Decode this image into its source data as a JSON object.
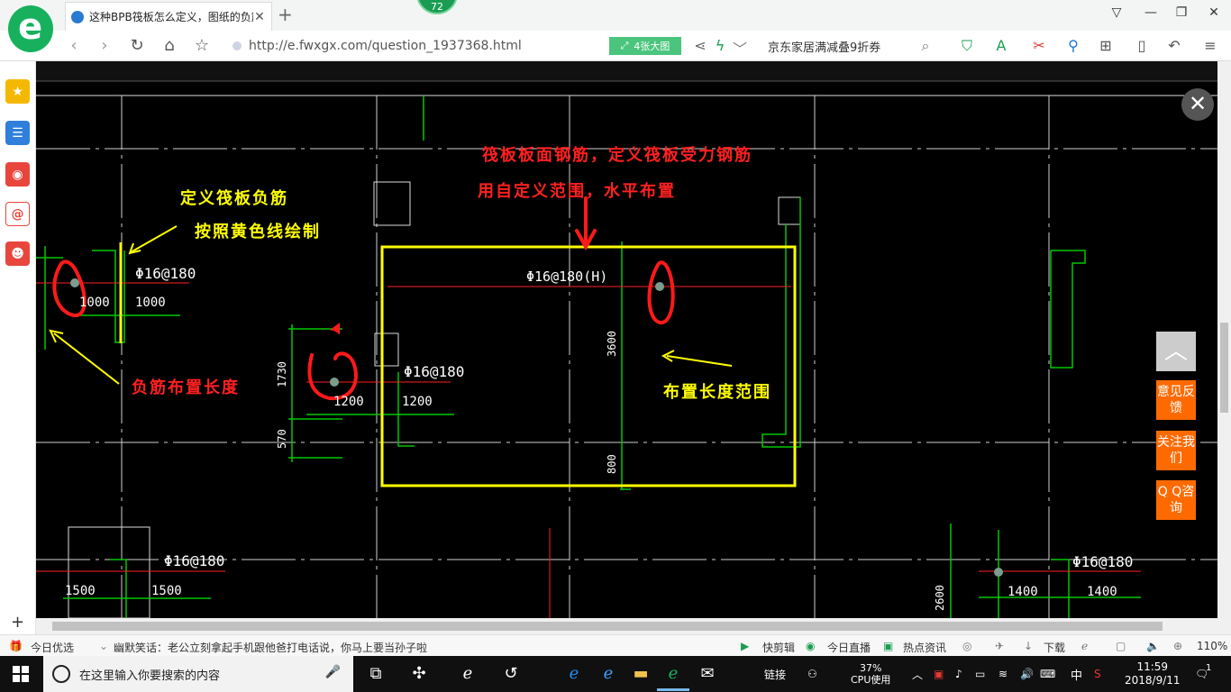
{
  "browser": {
    "tab_title": "这种BPB筏板怎么定义，图纸的负筋",
    "tab_close": "✕",
    "new_tab": "+",
    "badge": "72",
    "url": "http://e.fwxgx.com/question_1937368.html",
    "big_image_label": "4张大图",
    "search_hint": "京东家居满减叠9折券"
  },
  "drawing": {
    "title_line1": "筏板板面钢筋，定义筏板受力钢筋",
    "title_line2": "用自定义范围，水平布置",
    "note_neg1": "定义筏板负筋",
    "note_neg2": "按照黄色线绘制",
    "note_length": "负筋布置长度",
    "note_range": "布置长度范围",
    "rebar1": "Φ16@180",
    "rebar2": "Φ16@180(H)",
    "rebar3": "Φ16@180",
    "rebar4": "Φ16@180",
    "rebar5": "Φ16@180",
    "dim_1000a": "1000",
    "dim_1000b": "1000",
    "dim_1200a": "1200",
    "dim_1200b": "1200",
    "dim_1730": "1730",
    "dim_570": "570",
    "dim_3600": "3600",
    "dim_800": "800",
    "dim_1500a": "1500",
    "dim_1500b": "1500",
    "dim_1400a": "1400",
    "dim_1400b": "1400",
    "dim_2600": "2600"
  },
  "float": {
    "top_icon": "︿",
    "feedback": "意见反馈",
    "follow": "关注我们",
    "qq": "Q Q咨询",
    "close": "✕"
  },
  "status": {
    "today": "今日优选",
    "joke": "幽默笑话：老公立刻拿起手机跟他爸打电话说，你马上要当孙子啦",
    "clip": "快剪辑",
    "live": "今日直播",
    "news": "热点资讯",
    "download": "下载",
    "zoom": "110%"
  },
  "taskbar": {
    "search_placeholder": "在这里输入你要搜索的内容",
    "link": "链接",
    "cpu_pct": "37%",
    "cpu_label": "CPU使用",
    "lang": "中",
    "time": "11:59",
    "date": "2018/9/11",
    "notif": "1"
  },
  "colors": {
    "accent": "#17b15e",
    "float_orange": "#ff6a00",
    "cad_yellow": "#ffff00",
    "cad_red": "#ff2020",
    "cad_green": "#00c800"
  }
}
